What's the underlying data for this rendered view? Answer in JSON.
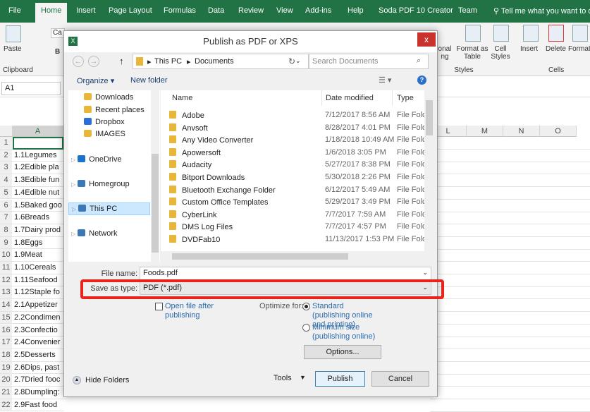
{
  "excel": {
    "tabs": [
      "File",
      "Home",
      "Insert",
      "Page Layout",
      "Formulas",
      "Data",
      "Review",
      "View",
      "Add-ins",
      "Help",
      "Soda PDF 10 Creator",
      "Team"
    ],
    "tell_me": "Tell me what you want to do",
    "ribbon": {
      "paste": "Paste",
      "clipboard": "Clipboard",
      "font_box": "Ca",
      "bold": "B",
      "cond_format": "onal ng",
      "format_as_table": "Format as Table",
      "cell_styles": "Cell Styles",
      "styles": "Styles",
      "insert": "Insert",
      "delete": "Delete",
      "format": "Format",
      "cells": "Cells"
    },
    "name_box": "A1",
    "columns": [
      "A",
      "L",
      "M",
      "N",
      "O"
    ],
    "rows": [
      {
        "n": "1",
        "v": ""
      },
      {
        "n": "2",
        "v": "1.1Legumes"
      },
      {
        "n": "3",
        "v": "1.2Edible pla"
      },
      {
        "n": "4",
        "v": "1.3Edible fun"
      },
      {
        "n": "5",
        "v": "1.4Edible nut"
      },
      {
        "n": "6",
        "v": "1.5Baked goo"
      },
      {
        "n": "7",
        "v": "1.6Breads"
      },
      {
        "n": "8",
        "v": "1.7Dairy prod"
      },
      {
        "n": "9",
        "v": "1.8Eggs"
      },
      {
        "n": "10",
        "v": "1.9Meat"
      },
      {
        "n": "11",
        "v": "1.10Cereals"
      },
      {
        "n": "12",
        "v": "1.11Seafood"
      },
      {
        "n": "13",
        "v": "1.12Staple fo"
      },
      {
        "n": "14",
        "v": "2.1Appetizer"
      },
      {
        "n": "15",
        "v": "2.2Condimen"
      },
      {
        "n": "16",
        "v": "2.3Confectio"
      },
      {
        "n": "17",
        "v": "2.4Convenier"
      },
      {
        "n": "18",
        "v": "2.5Desserts"
      },
      {
        "n": "19",
        "v": "2.6Dips, past"
      },
      {
        "n": "20",
        "v": "2.7Dried fooc"
      },
      {
        "n": "21",
        "v": "2.8Dumpling:"
      },
      {
        "n": "22",
        "v": "2.9Fast food"
      }
    ]
  },
  "dialog": {
    "title": "Publish as PDF or XPS",
    "close": "x",
    "path": [
      "This PC",
      "Documents"
    ],
    "search_placeholder": "Search Documents",
    "organize": "Organize ▾",
    "new_folder": "New folder",
    "help": "?",
    "nav": [
      {
        "label": "Downloads",
        "icon": "downloads-icon"
      },
      {
        "label": "Recent places",
        "icon": "recent-icon"
      },
      {
        "label": "Dropbox",
        "icon": "dropbox-icon"
      },
      {
        "label": "IMAGES",
        "icon": "folder-icon"
      },
      {
        "label": "OneDrive",
        "icon": "cloud-icon"
      },
      {
        "label": "Homegroup",
        "icon": "homegroup-icon"
      },
      {
        "label": "This PC",
        "icon": "computer-icon",
        "selected": true
      },
      {
        "label": "Network",
        "icon": "network-icon"
      }
    ],
    "columns": {
      "name": "Name",
      "date": "Date modified",
      "type": "Type"
    },
    "files": [
      {
        "name": "Adobe",
        "date": "7/12/2017 8:56 AM",
        "type": "File Folder"
      },
      {
        "name": "Anvsoft",
        "date": "8/28/2017 4:01 PM",
        "type": "File Folder"
      },
      {
        "name": "Any Video Converter",
        "date": "1/18/2018 10:49 AM",
        "type": "File Folder"
      },
      {
        "name": "Apowersoft",
        "date": "1/6/2018 3:05 PM",
        "type": "File Folder"
      },
      {
        "name": "Audacity",
        "date": "5/27/2017 8:38 PM",
        "type": "File Folder"
      },
      {
        "name": "Bitport Downloads",
        "date": "5/30/2018 2:26 PM",
        "type": "File Folder"
      },
      {
        "name": "Bluetooth Exchange Folder",
        "date": "6/12/2017 5:49 AM",
        "type": "File Folder"
      },
      {
        "name": "Custom Office Templates",
        "date": "5/29/2017 3:49 PM",
        "type": "File Folder"
      },
      {
        "name": "CyberLink",
        "date": "7/7/2017 7:59 AM",
        "type": "File Folder"
      },
      {
        "name": "DMS Log Files",
        "date": "7/7/2017 4:57 PM",
        "type": "File Folder"
      },
      {
        "name": "DVDFab10",
        "date": "11/13/2017 1:53 PM",
        "type": "File Folder"
      }
    ],
    "file_name_label": "File name:",
    "file_name": "Foods.pdf",
    "save_type_label": "Save as type:",
    "save_type": "PDF (*.pdf)",
    "open_after": "Open file after publishing",
    "open_after_checked": false,
    "optimize_label": "Optimize for:",
    "opt_standard": "Standard (publishing online and printing)",
    "opt_minimum": "Minimum size (publishing online)",
    "selected_option": "standard",
    "options_btn": "Options...",
    "hide_folders": "Hide Folders",
    "tools": "Tools",
    "publish": "Publish",
    "cancel": "Cancel",
    "highlight_color": "#e8231c"
  }
}
